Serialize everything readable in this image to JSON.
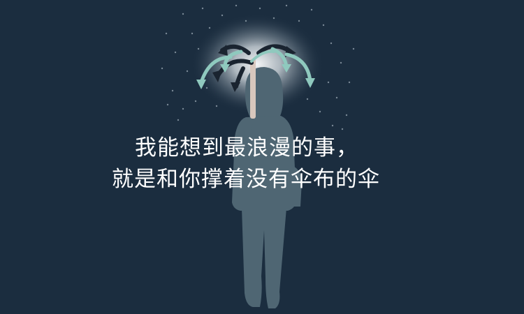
{
  "caption": {
    "line1": "我能想到最浪漫的事，",
    "line2": "就是和你撑着没有伞布的伞"
  },
  "colors": {
    "background": "#1b2d3f",
    "silhouette": "#4f6673",
    "glow": "#ffffff",
    "arrow_light": "#8fc9be",
    "arrow_dark": "#1a2430",
    "handle": "#d8c7bd",
    "text": "#ffffff"
  }
}
